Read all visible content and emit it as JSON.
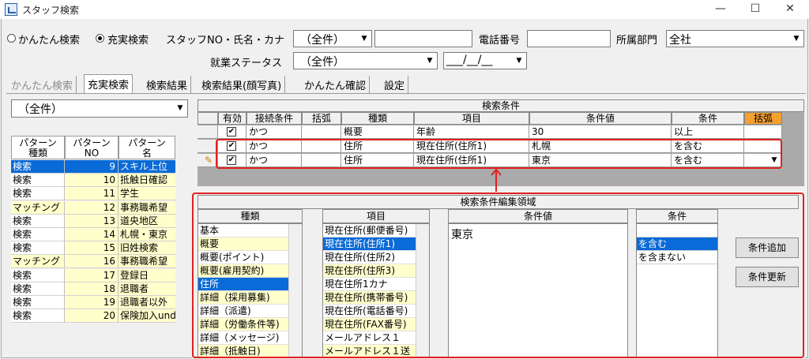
{
  "window": {
    "title": "スタッフ検索",
    "min": "—",
    "max": "☐",
    "close": "✕"
  },
  "search_mode": {
    "simple": "かんたん検索",
    "full": "充実検索",
    "selected": "full"
  },
  "filters": {
    "staff_label": "スタッフNO・氏名・カナ",
    "staff_select": "（全件）",
    "staff_text": "",
    "phone_label": "電話番号",
    "phone_value": "",
    "dept_label": "所属部門",
    "dept_value": "全社",
    "employment_label": "就業ステータス",
    "employment_value": "（全件）",
    "date_value": "___/__/__"
  },
  "tabs": [
    "かんたん検索",
    "充実検索",
    "検索結果",
    "検索結果(顔写真)",
    "かんたん確認",
    "設定"
  ],
  "active_tab": 1,
  "pattern_filter": "（全件）",
  "pattern_table": {
    "headers": [
      "パターン\n種類",
      "パターン\nNO",
      "パターン\n名"
    ],
    "rows": [
      {
        "type": "検索",
        "no": "9",
        "name": "スキル上位",
        "selected": true
      },
      {
        "type": "検索",
        "no": "10",
        "name": "抵触日確認"
      },
      {
        "type": "検索",
        "no": "11",
        "name": "学生"
      },
      {
        "type": "マッチング",
        "no": "12",
        "name": "事務職希望"
      },
      {
        "type": "検索",
        "no": "13",
        "name": "道央地区"
      },
      {
        "type": "検索",
        "no": "14",
        "name": "札幌・東京"
      },
      {
        "type": "検索",
        "no": "15",
        "name": "旧姓検索"
      },
      {
        "type": "マッチング",
        "no": "16",
        "name": "事務職希望"
      },
      {
        "type": "検索",
        "no": "17",
        "name": "登録日"
      },
      {
        "type": "検索",
        "no": "18",
        "name": "退職者"
      },
      {
        "type": "検索",
        "no": "19",
        "name": "退職者以外"
      },
      {
        "type": "検索",
        "no": "20",
        "name": "保険加入under"
      }
    ]
  },
  "conditions": {
    "title": "検索条件",
    "headers": [
      "有効",
      "接続条件",
      "括弧",
      "種類",
      "項目",
      "条件値",
      "条件",
      "括弧"
    ],
    "rows": [
      {
        "active": "✔",
        "conj": "かつ",
        "paren1": "",
        "kind": "概要",
        "item": "年齢",
        "value": "30",
        "cond": "以上",
        "paren2": ""
      },
      {
        "active": "✔",
        "conj": "かつ",
        "paren1": "",
        "kind": "住所",
        "item": "現在住所(住所1)",
        "value": "札幌",
        "cond": "を含む",
        "paren2": ""
      },
      {
        "active": "✔",
        "conj": "かつ",
        "paren1": "",
        "kind": "住所",
        "item": "現在住所(住所1)",
        "value": "東京",
        "cond": "を含む",
        "paren2": ""
      }
    ]
  },
  "edit_area": {
    "title": "検索条件編集領域",
    "kind_header": "種類",
    "kinds": [
      "基本",
      "概要",
      "概要(ポイント)",
      "概要(雇用契約)",
      "住所",
      "詳細（採用募集)",
      "詳細（派遣)",
      "詳細（労働条件等)",
      "詳細（メッセージ)",
      "詳細（抵触日)"
    ],
    "kind_selected": 4,
    "item_header": "項目",
    "items": [
      "現在住所(郵便番号)",
      "現在住所(住所1)",
      "現在住所(住所2)",
      "現在住所(住所3)",
      "現在住所1カナ",
      "現在住所(携帯番号)",
      "現在住所(電話番号)",
      "現在住所(FAX番号)",
      "メールアドレス１",
      "メールアドレス１送"
    ],
    "item_selected": 1,
    "value_header": "条件値",
    "value": "東京",
    "cond_header": "条件",
    "conds": [
      "",
      "を含む",
      "を含まない"
    ],
    "cond_selected": 1,
    "add_button": "条件追加",
    "update_button": "条件更新"
  }
}
